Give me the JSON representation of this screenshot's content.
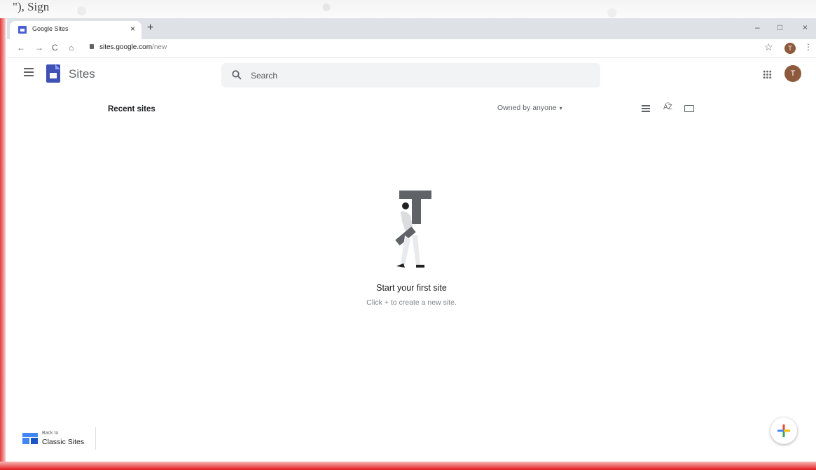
{
  "paper": {
    "text": "\"), Sign"
  },
  "browser": {
    "tab_title": "Google Sites",
    "tab_close": "×",
    "new_tab": "+",
    "window_controls": {
      "minimize": "–",
      "maximize": "□",
      "close": "×"
    },
    "nav": {
      "back": "←",
      "forward": "→",
      "reload": "C",
      "home": "⌂"
    },
    "url_host": "sites.google.com",
    "url_path": "/new",
    "bookmark": "☆",
    "profile_initial": "T",
    "menu": "⋮"
  },
  "app": {
    "name": "Sites",
    "search_placeholder": "Search",
    "avatar_initial": "T"
  },
  "list": {
    "title": "Recent sites",
    "owner_filter": "Owned by anyone",
    "owner_caret": "▾",
    "sort_label": "A͡Z"
  },
  "empty_state": {
    "title": "Start your first site",
    "subtitle": "Click + to create a new site."
  },
  "classic": {
    "small": "Back to",
    "label": "Classic Sites"
  },
  "icons": [
    "menu-icon",
    "sites-logo-icon",
    "search-icon",
    "apps-grid-icon",
    "list-view-icon",
    "sort-az-icon",
    "folder-icon",
    "plus-icon"
  ],
  "colors": {
    "accent": "#3f51b5",
    "avatar": "#8d5a3e",
    "fab_plus": [
      "#ea4335",
      "#4285f4",
      "#fbbc05",
      "#34a853"
    ]
  }
}
